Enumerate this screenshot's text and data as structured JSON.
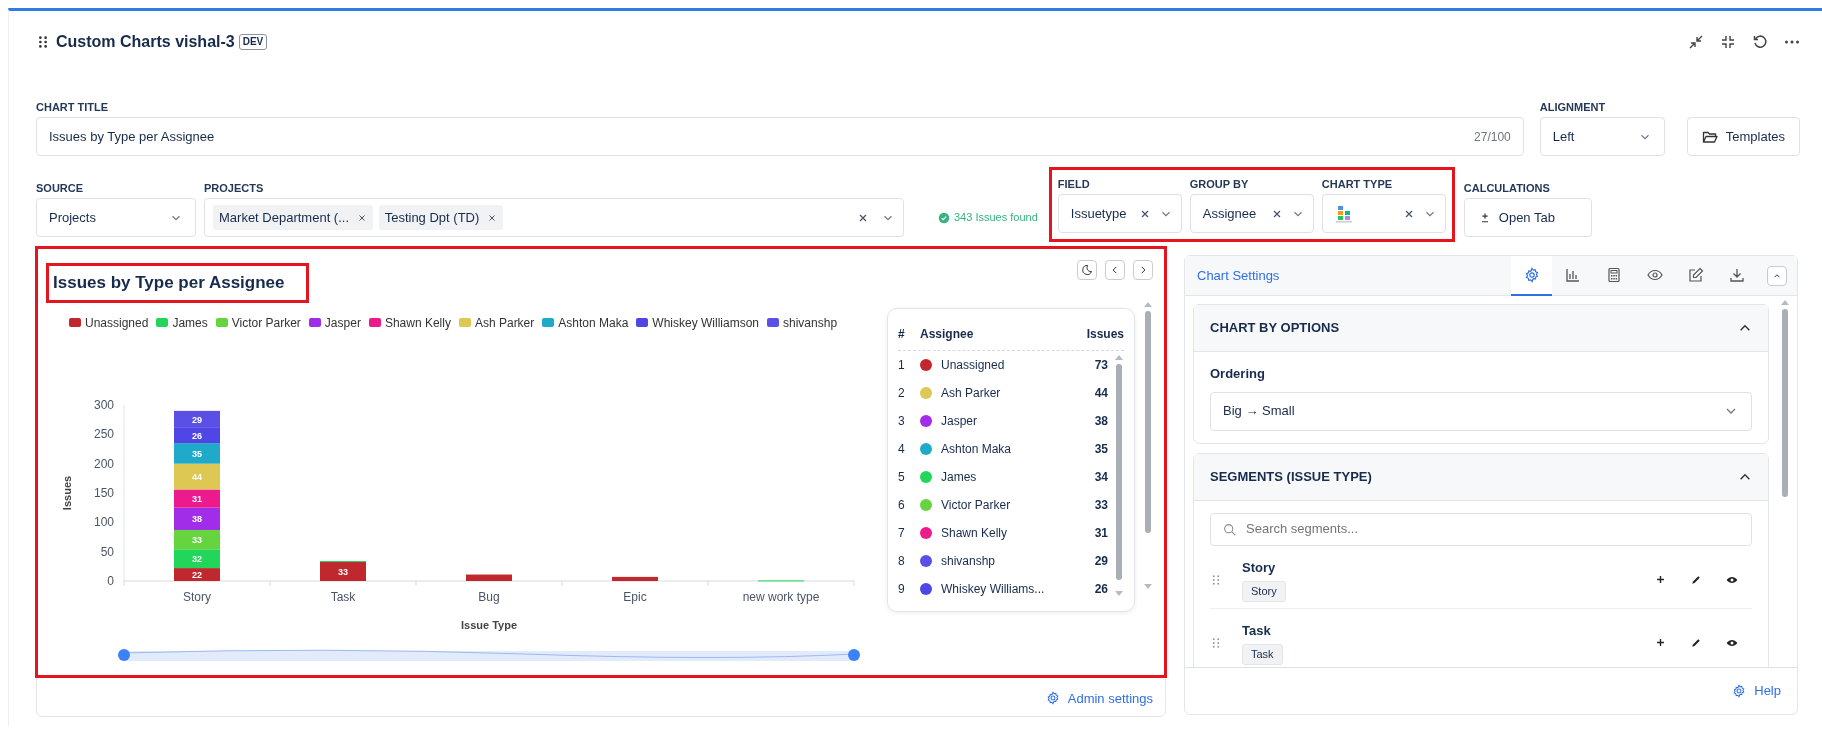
{
  "header": {
    "title": "Custom Charts vishal-3",
    "badge": "DEV"
  },
  "chart_title_field": {
    "label": "CHART TITLE",
    "value": "Issues by Type per Assignee",
    "counter": "27/100"
  },
  "alignment": {
    "label": "ALIGNMENT",
    "value": "Left"
  },
  "templates_button": "Templates",
  "source": {
    "label": "SOURCE",
    "value": "Projects"
  },
  "projects": {
    "label": "PROJECTS",
    "tags": [
      "Market Department (...",
      "Testing Dpt (TD)"
    ]
  },
  "issues_found": "343 Issues found",
  "config_group": {
    "highlighted": true,
    "field": {
      "label": "FIELD",
      "value": "Issuetype"
    },
    "group_by": {
      "label": "GROUP BY",
      "value": "Assignee"
    },
    "chart_type": {
      "label": "CHART TYPE"
    }
  },
  "calculations": {
    "label": "CALCULATIONS",
    "button": "Open Tab"
  },
  "chart_panel": {
    "highlighted": true,
    "title": "Issues by Type per Assignee",
    "title_highlighted": true,
    "chart_data": {
      "type": "bar",
      "stacked": true,
      "legend": true,
      "value_labels": [
        [
          "22",
          "33",
          null,
          null,
          null
        ],
        [
          "32",
          null,
          null,
          null,
          null
        ],
        [
          "33",
          null,
          null,
          null,
          null
        ],
        [
          "38",
          null,
          null,
          null,
          null
        ],
        [
          "31",
          null,
          null,
          null,
          null
        ],
        [
          "44",
          null,
          null,
          null,
          null
        ],
        [
          "35",
          null,
          null,
          null,
          null
        ],
        [
          "26",
          null,
          null,
          null,
          null
        ],
        [
          "29",
          null,
          null,
          null,
          null
        ]
      ],
      "xlabel": "Issue Type",
      "ylabel": "Issues",
      "categories": [
        "Story",
        "Task",
        "Bug",
        "Epic",
        "new work type"
      ],
      "ylim": [
        0,
        300
      ],
      "yticks": [
        0,
        50,
        100,
        150,
        200,
        250,
        300
      ],
      "series": [
        {
          "name": "Unassigned",
          "color": "#c0282d",
          "values": [
            22,
            33,
            11,
            7,
            null
          ]
        },
        {
          "name": "James",
          "color": "#22d65a",
          "values": [
            32,
            1,
            null,
            null,
            1
          ]
        },
        {
          "name": "Victor Parker",
          "color": "#66d43f",
          "values": [
            33,
            null,
            null,
            null,
            null
          ]
        },
        {
          "name": "Jasper",
          "color": "#a22de8",
          "values": [
            38,
            null,
            null,
            null,
            null
          ]
        },
        {
          "name": "Shawn Kelly",
          "color": "#ec1a8c",
          "values": [
            31,
            null,
            null,
            null,
            null
          ]
        },
        {
          "name": "Ash Parker",
          "color": "#dcc853",
          "values": [
            44,
            null,
            null,
            null,
            null
          ]
        },
        {
          "name": "Ashton Maka",
          "color": "#1eaac8",
          "values": [
            35,
            null,
            null,
            null,
            null
          ]
        },
        {
          "name": "Whiskey Williamson",
          "color": "#4f46e5",
          "values": [
            26,
            null,
            null,
            null,
            null
          ]
        },
        {
          "name": "shivanshp",
          "color": "#5b50e6",
          "values": [
            29,
            null,
            null,
            null,
            null
          ]
        }
      ]
    },
    "legend_table": {
      "columns": [
        "#",
        "Assignee",
        "Issues"
      ],
      "rows": [
        {
          "rank": "1",
          "name": "Unassigned",
          "color": "#c0282d",
          "issues": "73"
        },
        {
          "rank": "2",
          "name": "Ash Parker",
          "color": "#dcc853",
          "issues": "44"
        },
        {
          "rank": "3",
          "name": "Jasper",
          "color": "#a22de8",
          "issues": "38"
        },
        {
          "rank": "4",
          "name": "Ashton Maka",
          "color": "#1eaac8",
          "issues": "35"
        },
        {
          "rank": "5",
          "name": "James",
          "color": "#22d65a",
          "issues": "34"
        },
        {
          "rank": "6",
          "name": "Victor Parker",
          "color": "#66d43f",
          "issues": "33"
        },
        {
          "rank": "7",
          "name": "Shawn Kelly",
          "color": "#ec1a8c",
          "issues": "31"
        },
        {
          "rank": "8",
          "name": "shivanshp",
          "color": "#5b50e6",
          "issues": "29"
        },
        {
          "rank": "9",
          "name": "Whiskey Williams...",
          "color": "#4f46e5",
          "issues": "26"
        }
      ]
    }
  },
  "admin_link": "Admin settings",
  "settings_panel": {
    "title": "Chart Settings",
    "tabs": [
      {
        "kind": "settings",
        "selected": true
      },
      {
        "kind": "chart",
        "selected": false
      },
      {
        "kind": "calculator",
        "selected": false
      },
      {
        "kind": "view",
        "selected": false
      },
      {
        "kind": "edit",
        "selected": false
      },
      {
        "kind": "download",
        "selected": false
      }
    ],
    "sections": [
      {
        "kind": "options",
        "title": "CHART BY OPTIONS",
        "expanded": true,
        "label": "Ordering",
        "value": "Big → Small"
      },
      {
        "kind": "segments",
        "title": "SEGMENTS (ISSUE TYPE)",
        "expanded": true,
        "placeholder": "Search segments...",
        "items": [
          {
            "name": "Story",
            "tag": "Story"
          },
          {
            "name": "Task",
            "tag": "Task"
          }
        ]
      }
    ],
    "help": "Help"
  }
}
